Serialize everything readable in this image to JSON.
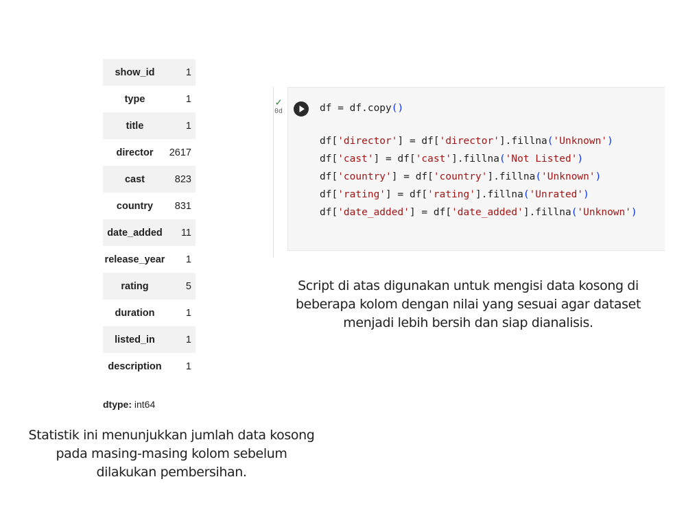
{
  "null_counts": {
    "rows": [
      {
        "column": "show_id",
        "count": "1"
      },
      {
        "column": "type",
        "count": "1"
      },
      {
        "column": "title",
        "count": "1"
      },
      {
        "column": "director",
        "count": "2617"
      },
      {
        "column": "cast",
        "count": "823"
      },
      {
        "column": "country",
        "count": "831"
      },
      {
        "column": "date_added",
        "count": "11"
      },
      {
        "column": "release_year",
        "count": "1"
      },
      {
        "column": "rating",
        "count": "5"
      },
      {
        "column": "duration",
        "count": "1"
      },
      {
        "column": "listed_in",
        "count": "1"
      },
      {
        "column": "description",
        "count": "1"
      }
    ],
    "dtype_label": "dtype:",
    "dtype_value": " int64"
  },
  "caption_left": "Statistik ini menunjukkan jumlah data kosong pada masing-masing kolom sebelum dilakukan pembersihan.",
  "code_cell": {
    "status_check": "✓",
    "status_time": "0d",
    "lines": [
      [
        {
          "t": "df = df.copy"
        },
        {
          "t": "()",
          "c": "paren"
        }
      ],
      [],
      [
        {
          "t": "df["
        },
        {
          "t": "'director'",
          "c": "str"
        },
        {
          "t": "] = df["
        },
        {
          "t": "'director'",
          "c": "str"
        },
        {
          "t": "].fillna"
        },
        {
          "t": "(",
          "c": "paren"
        },
        {
          "t": "'Unknown'",
          "c": "str"
        },
        {
          "t": ")",
          "c": "paren"
        }
      ],
      [
        {
          "t": "df["
        },
        {
          "t": "'cast'",
          "c": "str"
        },
        {
          "t": "] = df["
        },
        {
          "t": "'cast'",
          "c": "str"
        },
        {
          "t": "].fillna"
        },
        {
          "t": "(",
          "c": "paren"
        },
        {
          "t": "'Not Listed'",
          "c": "str"
        },
        {
          "t": ")",
          "c": "paren"
        }
      ],
      [
        {
          "t": "df["
        },
        {
          "t": "'country'",
          "c": "str"
        },
        {
          "t": "] = df["
        },
        {
          "t": "'country'",
          "c": "str"
        },
        {
          "t": "].fillna"
        },
        {
          "t": "(",
          "c": "paren"
        },
        {
          "t": "'Unknown'",
          "c": "str"
        },
        {
          "t": ")",
          "c": "paren"
        }
      ],
      [
        {
          "t": "df["
        },
        {
          "t": "'rating'",
          "c": "str"
        },
        {
          "t": "] = df["
        },
        {
          "t": "'rating'",
          "c": "str"
        },
        {
          "t": "].fillna"
        },
        {
          "t": "(",
          "c": "paren"
        },
        {
          "t": "'Unrated'",
          "c": "str"
        },
        {
          "t": ")",
          "c": "paren"
        }
      ],
      [
        {
          "t": "df["
        },
        {
          "t": "'date_added'",
          "c": "str"
        },
        {
          "t": "] = df["
        },
        {
          "t": "'date_added'",
          "c": "str"
        },
        {
          "t": "].fillna"
        },
        {
          "t": "(",
          "c": "paren"
        },
        {
          "t": "'Unknown'",
          "c": "str"
        },
        {
          "t": ")",
          "c": "paren"
        }
      ]
    ]
  },
  "caption_right": "Script di atas digunakan untuk mengisi data kosong di beberapa kolom dengan nilai yang sesuai agar dataset menjadi lebih bersih dan siap dianalisis.",
  "icons": {
    "run": "play-circle-icon",
    "status": "checkmark-icon"
  },
  "colors": {
    "string": "#a31515",
    "paren": "#0431fa",
    "check": "#2e7d32",
    "run_button": "#2b2b2b"
  }
}
